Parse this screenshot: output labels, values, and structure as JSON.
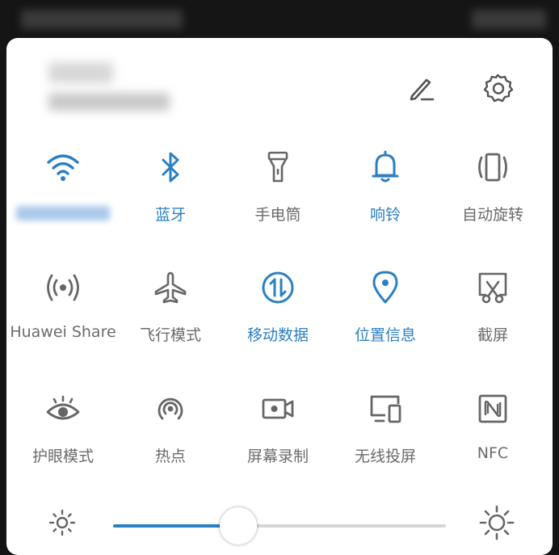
{
  "header": {
    "edit_icon": "pencil-icon",
    "settings_icon": "gear-icon"
  },
  "tiles": [
    {
      "id": "wifi",
      "label": "",
      "icon": "wifi-icon",
      "active": true
    },
    {
      "id": "bluetooth",
      "label": "蓝牙",
      "icon": "bluetooth-icon",
      "active": true
    },
    {
      "id": "flashlight",
      "label": "手电筒",
      "icon": "flashlight-icon",
      "active": false
    },
    {
      "id": "ringer",
      "label": "响铃",
      "icon": "bell-icon",
      "active": true
    },
    {
      "id": "autorotate",
      "label": "自动旋转",
      "icon": "rotate-icon",
      "active": false
    },
    {
      "id": "huaweishare",
      "label": "Huawei Share",
      "icon": "huawei-share-icon",
      "active": false
    },
    {
      "id": "airplane",
      "label": "飞行模式",
      "icon": "airplane-icon",
      "active": false
    },
    {
      "id": "mobiledata",
      "label": "移动数据",
      "icon": "mobile-data-icon",
      "active": true
    },
    {
      "id": "location",
      "label": "位置信息",
      "icon": "location-pin-icon",
      "active": true
    },
    {
      "id": "screenshot",
      "label": "截屏",
      "icon": "screenshot-scissors-icon",
      "active": false
    },
    {
      "id": "eyecomfort",
      "label": "护眼模式",
      "icon": "eye-icon",
      "active": false
    },
    {
      "id": "hotspot",
      "label": "热点",
      "icon": "hotspot-icon",
      "active": false
    },
    {
      "id": "screenrecord",
      "label": "屏幕录制",
      "icon": "video-camera-icon",
      "active": false
    },
    {
      "id": "wirelessprojection",
      "label": "无线投屏",
      "icon": "cast-screen-icon",
      "active": false
    },
    {
      "id": "nfc",
      "label": "NFC",
      "icon": "nfc-icon",
      "active": false
    }
  ],
  "brightness": {
    "level": 0.37,
    "low_icon": "sun-small-icon",
    "high_icon": "sun-large-icon"
  },
  "colors": {
    "accent": "#2b7fc3",
    "inactive": "#6b6b6b"
  }
}
